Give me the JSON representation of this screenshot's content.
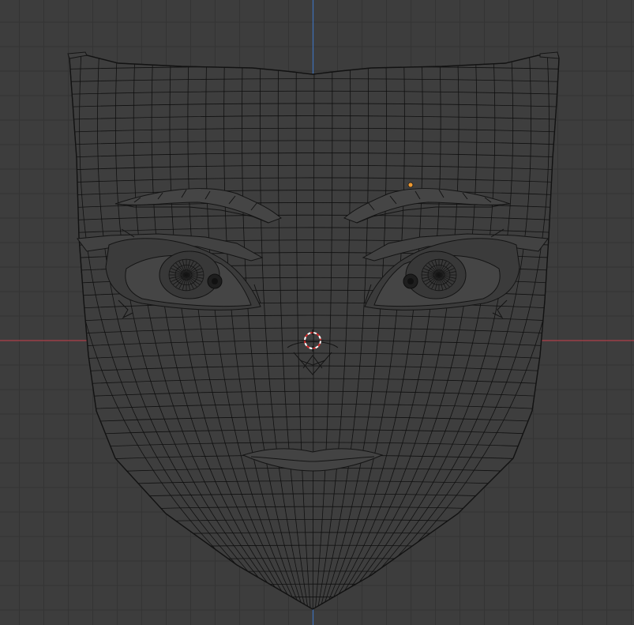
{
  "viewport": {
    "view": "front-orthographic",
    "shading": "wireframe",
    "theme": {
      "background": "#3d3d3d",
      "grid_line": "#343434",
      "x_axis": "#b04048",
      "z_axis": "#3f70b8",
      "wire": "#101010",
      "origin_dot": "#f09a30",
      "cursor_red": "#d82d2d",
      "cursor_white": "#ffffff"
    },
    "icons": {
      "cursor": "3d-cursor-icon",
      "origin": "object-origin-icon"
    }
  }
}
